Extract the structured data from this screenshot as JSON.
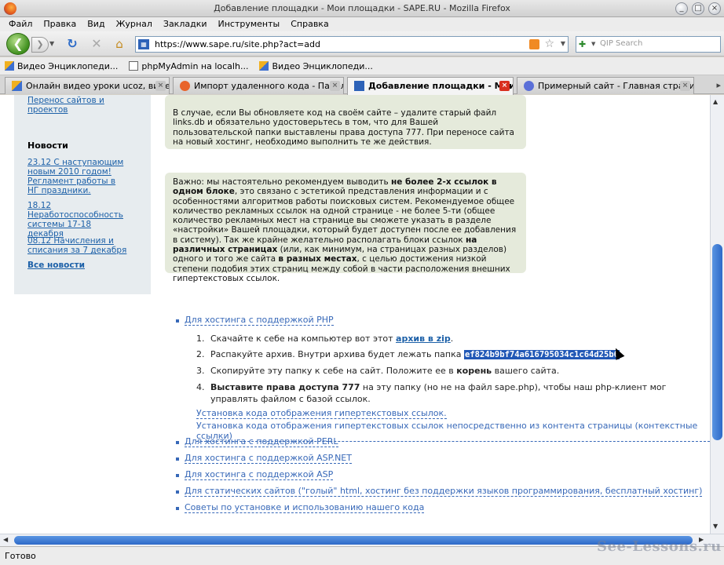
{
  "window": {
    "title": "Добавление площадки - Мои площадки - SAPE.RU - Mozilla Firefox",
    "min": "_",
    "max": "□",
    "close": "×"
  },
  "menu": [
    "Файл",
    "Правка",
    "Вид",
    "Журнал",
    "Закладки",
    "Инструменты",
    "Справка"
  ],
  "nav": {
    "back": "❮",
    "forward": "❯",
    "url": "https://www.sape.ru/site.php?act=add",
    "search_placeholder": "QIP Search"
  },
  "bookmarks": [
    "Видео Энциклопеди...",
    "phpMyAdmin на localh...",
    "Видео Энциклопеди..."
  ],
  "tabs": [
    {
      "label": "Онлайн видео уроки ucoz, видео у..."
    },
    {
      "label": "Импорт удаленного кода - Панель ..."
    },
    {
      "label": "Добавление площадки - Мои ..."
    },
    {
      "label": "Примерный сайт - Главная страница"
    }
  ],
  "sidebar": {
    "move_link": "Перенос сайтов и проектов",
    "news_heading": "Новости",
    "news": [
      "23.12 С наступающим новым 2010 годом! Регламент работы в НГ праздники.",
      "18.12 Неработоспособность системы 17-18 декабря",
      "08.12 Начисления и списания за 7 декабря"
    ],
    "all_news": "Все новости"
  },
  "note1": {
    "text": "В случае, если Вы обновляете код на своём сайте – удалите старый файл links.db и обязательно удостоверьтесь в том, что для Вашей пользовательской папки выставлены права доступа 777. При переносе сайта на новый хостинг, необходимо выполнить те же действия."
  },
  "note2": {
    "p1": "Важно: мы настоятельно рекомендуем выводить ",
    "b1": "не более 2-х ссылок в одном блоке",
    "p2": ", это связано с эстетикой представления информации и с особенностями алгоритмов работы поисковых систем. Рекомендуемое общее количество рекламных ссылок на одной странице - не более 5-ти (общее количество рекламных мест на странице вы сможете указать в разделе «настройки» Вашей площадки, который будет доступен после ее добавления в систему). Так же крайне желательно располагать блоки ссылок ",
    "b2": "на различных страницах",
    "p3": " (или, как минимум, на страницах разных разделов) одного и того же сайта ",
    "b3": "в разных местах",
    "p4": ", с целью достижения низкой степени подобия этих страниц между собой в части расположения внешних гипертекстовых ссылок."
  },
  "hosting": {
    "php": "Для хостинга с поддержкой PHP",
    "steps": {
      "s1_pre": "Скачайте к себе на компьютер вот этот ",
      "s1_link": "архив в zip",
      "s1_post": ".",
      "s2_pre": "Распакуйте архив. Внутри архива будет лежать папка ",
      "s2_hash": "ef824b9bf74a616795034c1c64d25b6",
      "s3_pre": "Скопируйте эту папку к себе на сайт. Положите ее в ",
      "s3_bold": "корень",
      "s3_post": " вашего сайта.",
      "s4_bold": "Выставите права доступа 777",
      "s4_rest": " на эту папку (но не на файл sape.php), чтобы наш php-клиент мог",
      "s4_line2": "управлять файлом с базой ссылок."
    },
    "install1": "Установка кода отображения гипертекстовых ссылок.",
    "install2": "Установка кода отображения гипертекстовых ссылок непосредственно из контента страницы (контекстные ссылки)",
    "others": [
      "Для хостинга с поддержкой PERL",
      "Для хостинга с поддержкой ASP.NET",
      "Для хостинга с поддержкой ASP",
      "Для статических сайтов (\"голый\" html, хостинг без поддержки языков программирования, бесплатный хостинг)",
      "Советы по установке и использованию нашего кода"
    ]
  },
  "status": "Готово",
  "watermark": "See-Lessons.ru"
}
